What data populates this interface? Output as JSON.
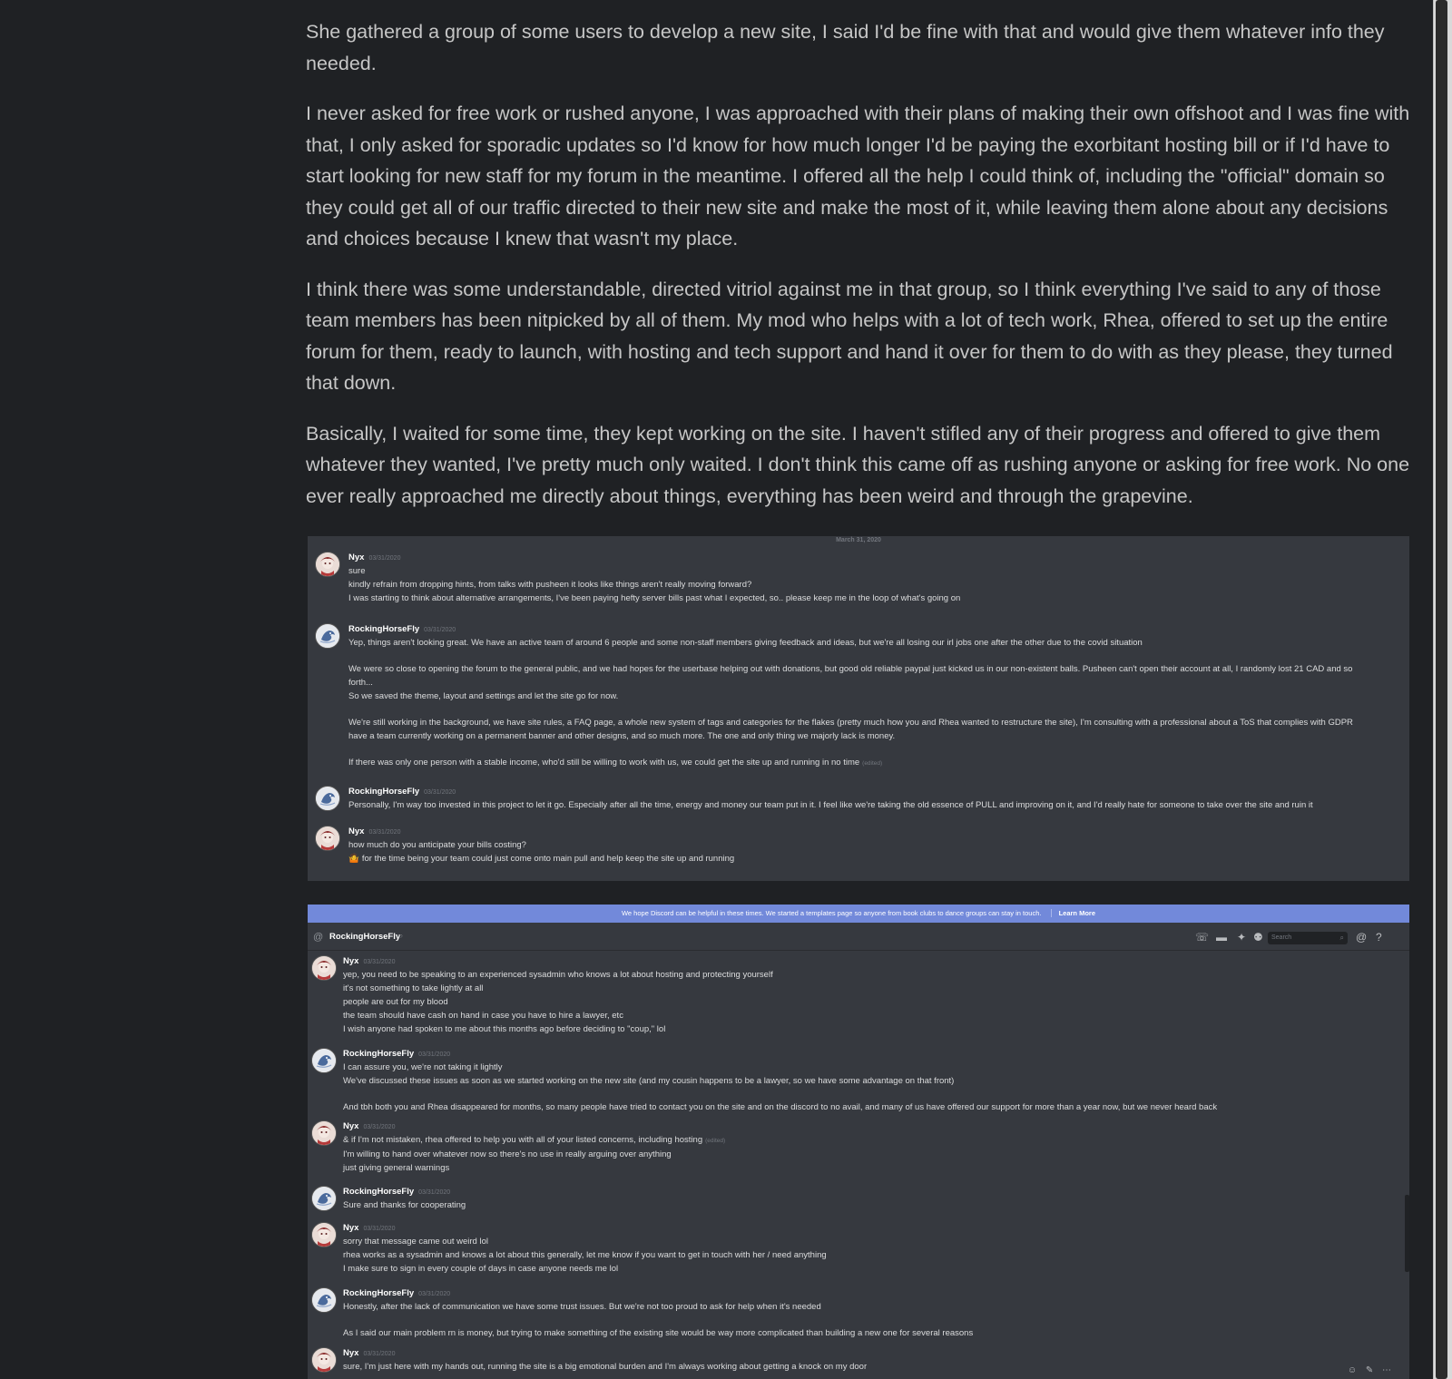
{
  "post": {
    "paragraphs": [
      "She gathered a group of some users to develop a new site, I said I'd be fine with that and would give them whatever info they needed.",
      "I never asked for free work or rushed anyone, I was approached with their plans of making their own offshoot and I was fine with that, I only asked for sporadic updates so I'd know for how much longer I'd be paying the exorbitant hosting bill or if I'd have to start looking for new staff for my forum in the meantime. I offered all the help I could think of, including the \"official\" domain so they could get all of our traffic directed to their new site and make the most of it, while leaving them alone about any decisions and choices because I knew that wasn't my place.",
      "I think there was some understandable, directed vitriol against me in that group, so I think everything I've said to any of those team members has been nitpicked by all of them. My mod who helps with a lot of tech work, Rhea, offered to set up the entire forum for them, ready to launch, with hosting and tech support and hand it over for them to do with as they please, they turned that down.",
      "Basically, I waited for some time, they kept working on the site. I haven't stifled any of their progress and offered to give them whatever they wanted, I've pretty much only waited. I don't think this came off as rushing anyone or asking for free work. No one ever really approached me directly about things, everything has been weird and through the grapevine."
    ]
  },
  "screenshot1": {
    "date_divider": "March 31, 2020",
    "messages": [
      {
        "author": "Nyx",
        "time": "03/31/2020",
        "avatar": "nyx-avatar-icon",
        "lines": [
          {
            "text": "sure"
          },
          {
            "text": "kindly refrain from dropping hints, from talks with pusheen it looks like things aren't really moving forward?"
          },
          {
            "text": "I was starting to think about alternative arrangements, I've been paying hefty server bills past what I expected, so.. please keep me in the loop of what's going on"
          }
        ]
      },
      {
        "author": "RockingHorseFly",
        "time": "03/31/2020",
        "avatar": "rockinghorsefly-avatar-icon",
        "lines": [
          {
            "text": "Yep, things aren't looking great. We have an active team of around 6 people and some non-staff members giving feedback and ideas, but we're all losing our irl jobs one after the other due to the covid situation"
          },
          {
            "text": "We were so close to opening the forum to the general public, and we had hopes for the userbase helping out with donations, but good old reliable paypal just kicked us in our non-existent balls. Pusheen can't open their account at all, I randomly lost 21 CAD and so",
            "gap": true
          },
          {
            "text": "forth..."
          },
          {
            "text": "So we saved the theme, layout and settings and let the site go for now."
          },
          {
            "text": "We're still working in the background, we have site rules, a FAQ page, a whole new system of tags and categories for the flakes (pretty much how you and Rhea wanted to restructure the site), I'm consulting with a professional about a ToS that complies with GDPR",
            "gap": true
          },
          {
            "text": "have a team currently working on a permanent banner and other designs, and so much more. The one and only thing we majorly lack is money."
          },
          {
            "text": "If there was only one person with a stable income, who'd still be willing to work with us, we could get the site up and running in no time",
            "gap": true,
            "edited": "(edited)"
          }
        ]
      },
      {
        "author": "RockingHorseFly",
        "time": "03/31/2020",
        "avatar": "rockinghorsefly-avatar-icon",
        "lines": [
          {
            "text": "Personally, I'm way too invested in this project to let it go. Especially after all the time, energy and money our team put in it. I feel like we're taking the old essence of PULL and improving on it, and I'd really hate for someone to take over the site and ruin it"
          }
        ]
      },
      {
        "author": "Nyx",
        "time": "03/31/2020",
        "avatar": "nyx-avatar-icon",
        "lines": [
          {
            "text": "how much do you anticipate your bills costing?"
          },
          {
            "text": "for the time being your team could just come onto main pull and help keep the site up and running",
            "emoji": "🤷"
          }
        ]
      }
    ]
  },
  "screenshot2": {
    "banner_text": "We hope Discord can be helpful in these times. We started a templates page so anyone from book clubs to dance groups can stay in touch.",
    "banner_link": "Learn More",
    "channel_name": "RockingHorseFly",
    "search_placeholder": "Search",
    "messages": [
      {
        "author": "Nyx",
        "time": "03/31/2020",
        "avatar": "nyx-avatar-icon",
        "lines": [
          {
            "text": "yep, you need to be speaking to an experienced sysadmin who knows a lot about hosting and protecting yourself"
          },
          {
            "text": "it's not something to take lightly at all"
          },
          {
            "text": "people are out for my blood"
          },
          {
            "text": "the team should have cash on hand in case you have to hire a lawyer, etc"
          },
          {
            "text": "I wish anyone had spoken to me about this months ago before deciding to \"coup,\" lol"
          }
        ]
      },
      {
        "author": "RockingHorseFly",
        "time": "03/31/2020",
        "avatar": "rockinghorsefly-avatar-icon",
        "lines": [
          {
            "text": "I can assure you, we're not taking it lightly"
          },
          {
            "text": "We've discussed these issues as soon as we started working on the new site (and my cousin happens to be a lawyer, so we have some advantage on that front)"
          },
          {
            "text": "And tbh both you and Rhea disappeared for months, so many people have tried to contact you on the site and on the discord to no avail, and many of us have offered our support for more than a year now, but we never heard back",
            "gap": true
          }
        ]
      },
      {
        "author": "Nyx",
        "time": "03/31/2020",
        "avatar": "nyx-avatar-icon",
        "lines": [
          {
            "text": "& if I'm not mistaken, rhea offered to help you with all of your listed concerns, including hosting",
            "edited": "(edited)"
          },
          {
            "text": "I'm willing to hand over whatever now so there's no use in really arguing over anything"
          },
          {
            "text": "just giving general warnings"
          }
        ]
      },
      {
        "author": "RockingHorseFly",
        "time": "03/31/2020",
        "avatar": "rockinghorsefly-avatar-icon",
        "lines": [
          {
            "text": "Sure and thanks for cooperating"
          }
        ]
      },
      {
        "author": "Nyx",
        "time": "03/31/2020",
        "avatar": "nyx-avatar-icon",
        "lines": [
          {
            "text": "sorry that message came out weird lol"
          },
          {
            "text": "rhea works as a sysadmin and knows a lot about this generally, let me know if you want to get in touch with her / need anything"
          },
          {
            "text": "I make sure to sign in every couple of days in case anyone needs me lol"
          }
        ]
      },
      {
        "author": "RockingHorseFly",
        "time": "03/31/2020",
        "avatar": "rockinghorsefly-avatar-icon",
        "lines": [
          {
            "text": "Honestly, after the lack of communication we have some trust issues. But we're not too proud to ask for help when it's needed"
          },
          {
            "text": "As I said our main problem rn is money, but trying to make something of the existing site would be way more complicated than building a new one for several reasons",
            "gap": true
          }
        ]
      },
      {
        "author": "Nyx",
        "time": "03/31/2020",
        "avatar": "nyx-avatar-icon",
        "lines": [
          {
            "text": "sure, I'm just here with my hands out, running the site is a big emotional burden and I'm always working about getting a knock on my door"
          }
        ]
      }
    ]
  }
}
